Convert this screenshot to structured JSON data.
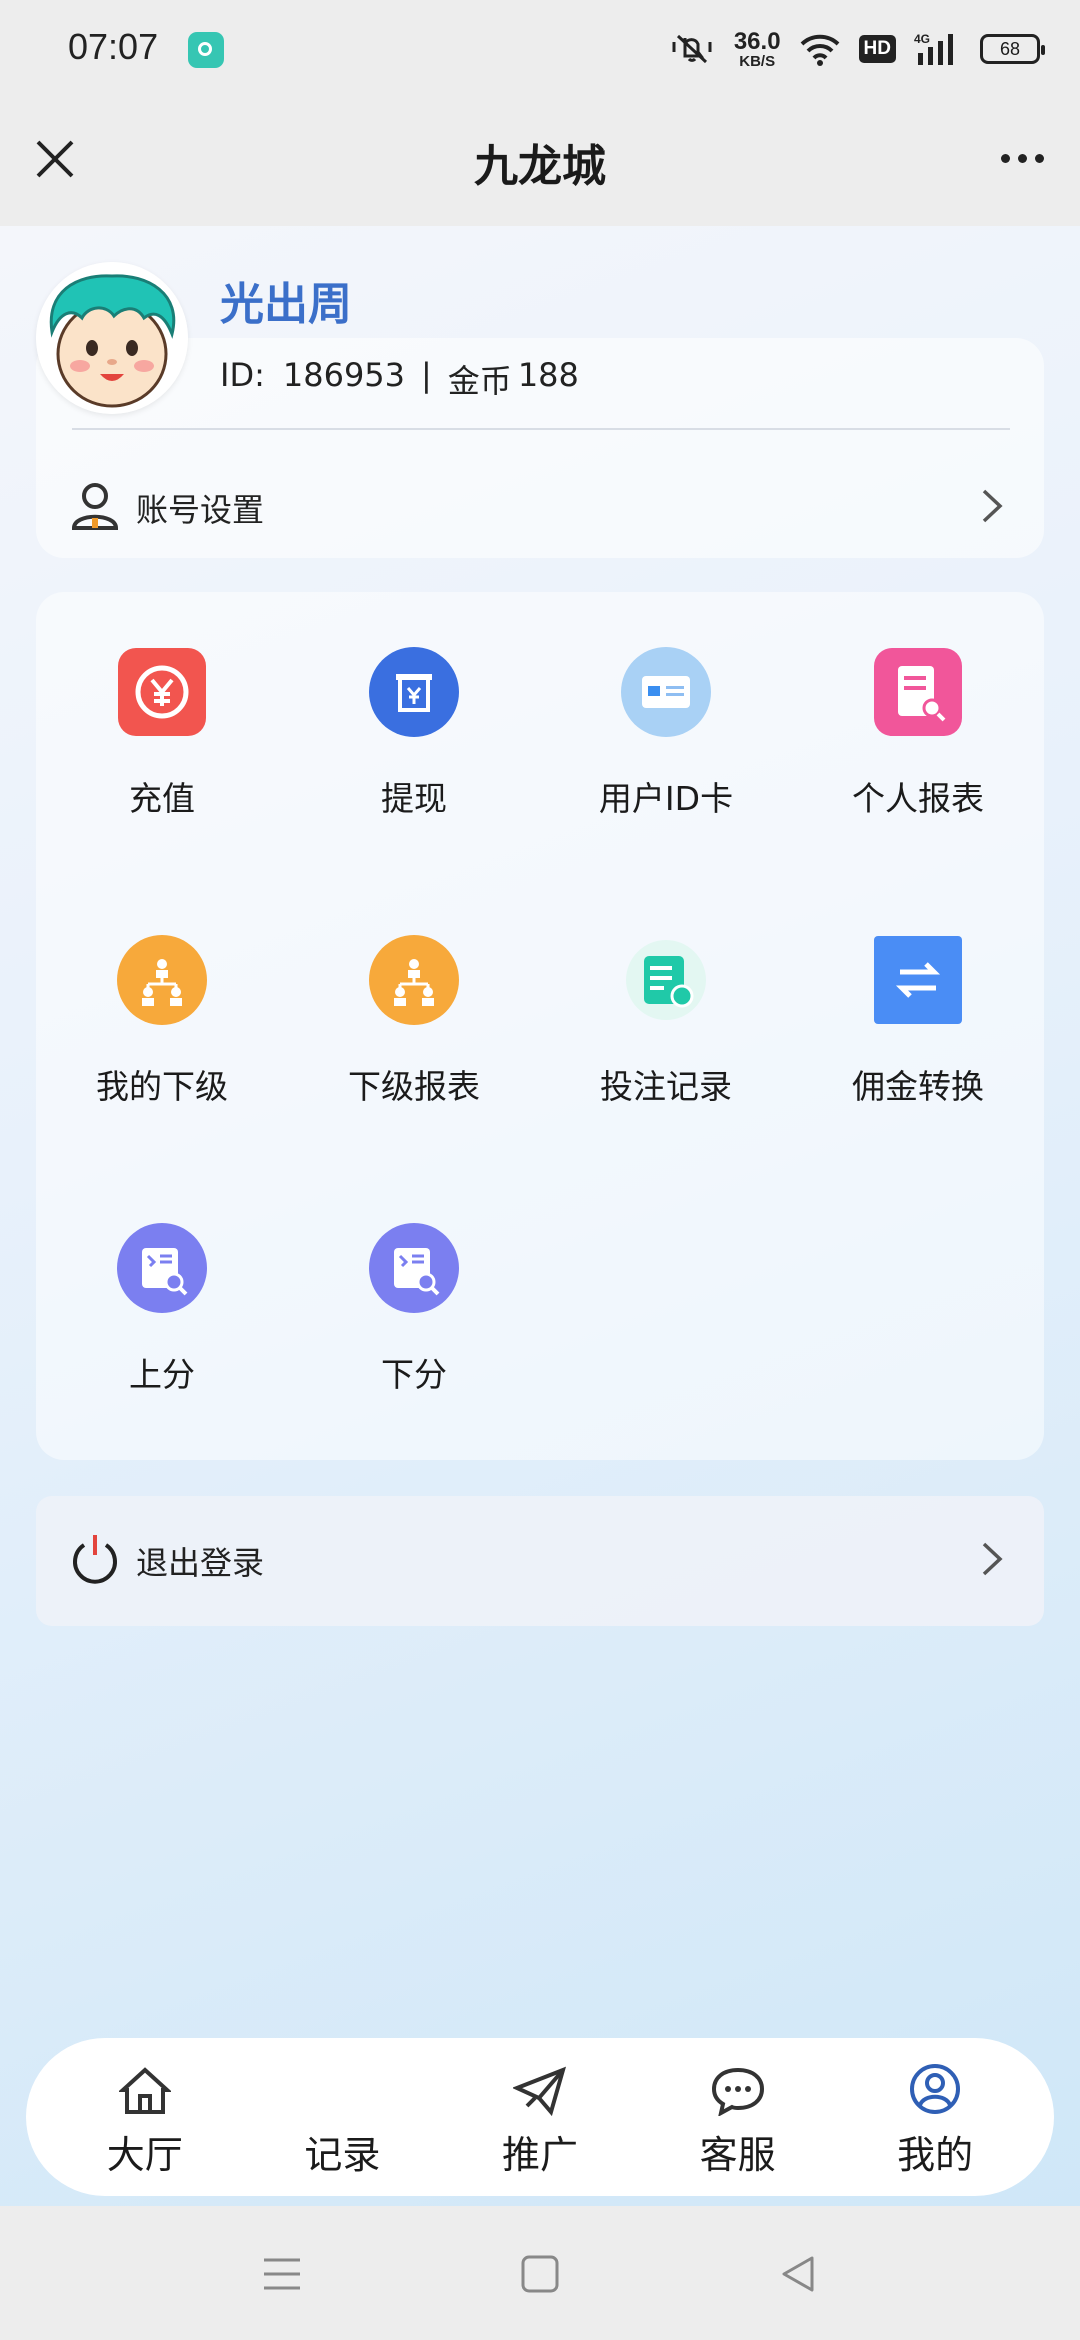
{
  "status_bar": {
    "time": "07:07",
    "net_speed_value": "36.0",
    "net_speed_unit": "KB/S",
    "hd_badge": "HD",
    "network": "4G",
    "battery": "68"
  },
  "header": {
    "title": "九龙城"
  },
  "profile": {
    "username": "光出周",
    "id_label": "ID:",
    "id_value": "186953",
    "separator": "|",
    "coins_label": "金币",
    "coins_value": "188",
    "settings_label": "账号设置"
  },
  "grid": {
    "items": [
      {
        "label": "充值",
        "icon": "recharge-icon",
        "color": "#f2554f"
      },
      {
        "label": "提现",
        "icon": "withdraw-icon",
        "color": "#3a6fe0"
      },
      {
        "label": "用户ID卡",
        "icon": "id-card-icon",
        "color": "#a9d1f5"
      },
      {
        "label": "个人报表",
        "icon": "report-icon",
        "color": "#f1569a"
      },
      {
        "label": "我的下级",
        "icon": "subordinates-icon",
        "color": "#f7a93b"
      },
      {
        "label": "下级报表",
        "icon": "subordinate-report-icon",
        "color": "#f7a93b"
      },
      {
        "label": "投注记录",
        "icon": "bet-record-icon",
        "color": "#20c9a8"
      },
      {
        "label": "佣金转换",
        "icon": "commission-transfer-icon",
        "color": "#4a8df5"
      },
      {
        "label": "上分",
        "icon": "score-up-icon",
        "color": "#7b7ff0"
      },
      {
        "label": "下分",
        "icon": "score-down-icon",
        "color": "#7b7ff0"
      }
    ]
  },
  "logout": {
    "label": "退出登录"
  },
  "bottom_nav": {
    "items": [
      {
        "label": "大厅",
        "icon": "home-icon"
      },
      {
        "label": "记录",
        "icon": ""
      },
      {
        "label": "推广",
        "icon": "paper-plane-icon"
      },
      {
        "label": "客服",
        "icon": "chat-icon"
      },
      {
        "label": "我的",
        "icon": "user-circle-icon",
        "active_color": "#2f5fb5"
      }
    ]
  }
}
